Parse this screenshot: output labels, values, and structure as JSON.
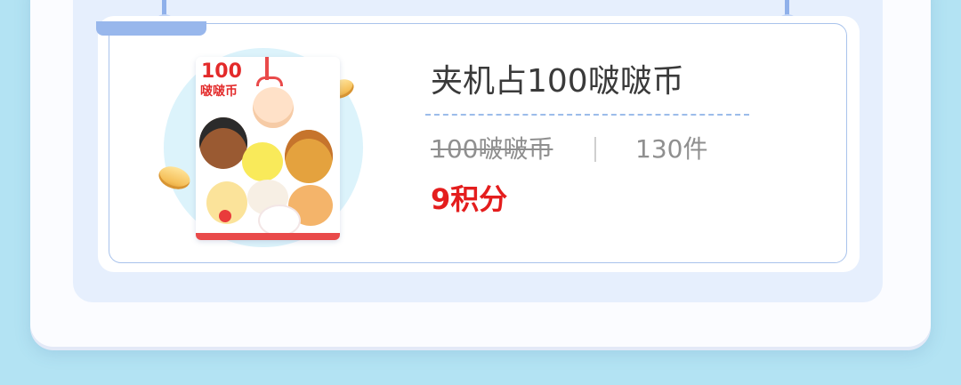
{
  "item": {
    "title": "夹机占100啵啵币",
    "original_price": "100啵啵币",
    "stock": "130件",
    "points": "9积分",
    "image": {
      "amount": "100",
      "unit": "啵啵币"
    }
  },
  "colors": {
    "background": "#b3e3f3",
    "panel": "#e6effd",
    "accent_blue": "#98b7ec",
    "price_red": "#e41d1d",
    "title_text": "#3a3a3a",
    "muted_text": "#8f8f8f"
  }
}
